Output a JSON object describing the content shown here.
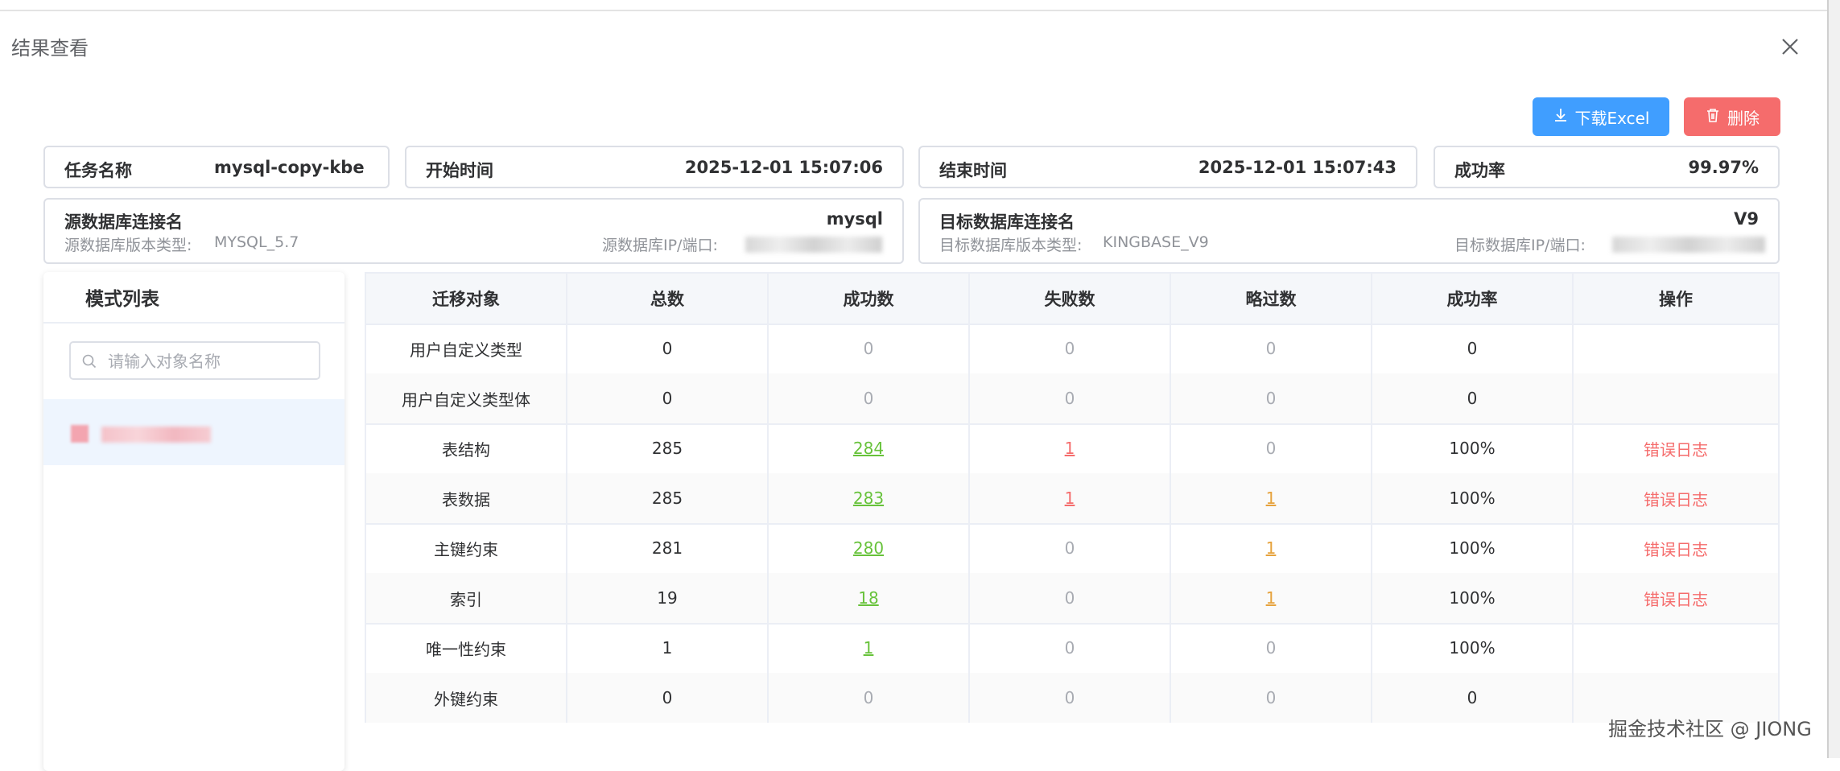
{
  "dialog": {
    "title": "结果查看"
  },
  "toolbar": {
    "download_label": "下载Excel",
    "delete_label": "删除"
  },
  "summary": {
    "task_name_label": "任务名称",
    "task_name_value": "mysql-copy-kbe",
    "start_label": "开始时间",
    "start_value": "2025-12-01 15:07:06",
    "end_label": "结束时间",
    "end_value": "2025-12-01 15:07:43",
    "rate_label": "成功率",
    "rate_value": "99.97%"
  },
  "source": {
    "label": "源数据库连接名",
    "name": "mysql",
    "version_label": "源数据库版本类型:",
    "version_value": "MYSQL_5.7",
    "ip_label": "源数据库IP/端口:"
  },
  "target": {
    "label": "目标数据库连接名",
    "name": "V9",
    "version_label": "目标数据库版本类型:",
    "version_value": "KINGBASE_V9",
    "ip_label": "目标数据库IP/端口:"
  },
  "schema": {
    "title": "模式列表",
    "search_placeholder": "请输入对象名称"
  },
  "table": {
    "headers": [
      "迁移对象",
      "总数",
      "成功数",
      "失败数",
      "略过数",
      "成功率",
      "操作"
    ],
    "rows": [
      {
        "obj": "用户自定义类型",
        "total": "0",
        "success": "0",
        "fail": "0",
        "skip": "0",
        "rate": "0",
        "op": ""
      },
      {
        "obj": "用户自定义类型体",
        "total": "0",
        "success": "0",
        "fail": "0",
        "skip": "0",
        "rate": "0",
        "op": ""
      },
      {
        "obj": "表结构",
        "total": "285",
        "success": "284",
        "fail": "1",
        "skip": "0",
        "rate": "100%",
        "op": "错误日志"
      },
      {
        "obj": "表数据",
        "total": "285",
        "success": "283",
        "fail": "1",
        "skip": "1",
        "rate": "100%",
        "op": "错误日志"
      },
      {
        "obj": "主键约束",
        "total": "281",
        "success": "280",
        "fail": "0",
        "skip": "1",
        "rate": "100%",
        "op": "错误日志"
      },
      {
        "obj": "索引",
        "total": "19",
        "success": "18",
        "fail": "0",
        "skip": "1",
        "rate": "100%",
        "op": "错误日志"
      },
      {
        "obj": "唯一性约束",
        "total": "1",
        "success": "1",
        "fail": "0",
        "skip": "0",
        "rate": "100%",
        "op": ""
      },
      {
        "obj": "外键约束",
        "total": "0",
        "success": "0",
        "fail": "0",
        "skip": "0",
        "rate": "0",
        "op": ""
      }
    ]
  },
  "watermark": "掘金技术社区 @ JIONG"
}
